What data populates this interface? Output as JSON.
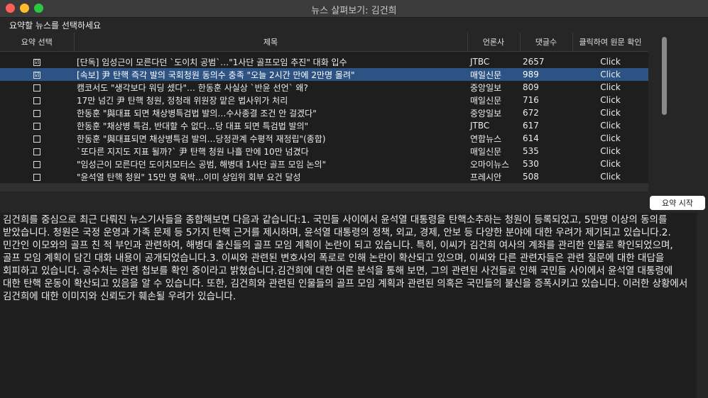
{
  "window": {
    "title": "뉴스 살펴보기: 김건희"
  },
  "colors": {
    "close": "#fe5f57",
    "minimize": "#febc2e",
    "maximize": "#28c840",
    "selection": "#2c5383"
  },
  "prompt": "요약할 뉴스를 선택하세요",
  "table": {
    "headers": {
      "select": "요약 선택",
      "title": "제목",
      "publisher": "언론사",
      "comments": "댓글수",
      "link": "클릭하여 원문 확인"
    },
    "rows": [
      {
        "checked": "☑",
        "title": "[단독] 임성근이 모른다던 `도이치 공범`…\"1사단 골프모임 추진\" 대화 입수",
        "publisher": "JTBC",
        "comments": "2657",
        "link": "Click"
      },
      {
        "checked": "☑",
        "title": "[속보] 尹 탄핵 즉각 발의 국회청원 동의수 충족 \"오늘 2시간 만에 2만명 몰려\"",
        "publisher": "매일신문",
        "comments": "989",
        "link": "Click"
      },
      {
        "checked": "",
        "title": "캠코서도 \"생각보다 워딩 셌다\"… 한동훈 사실상 `반윤 선언` 왜?",
        "publisher": "중앙일보",
        "comments": "809",
        "link": "Click"
      },
      {
        "checked": "",
        "title": "17만 넘긴 尹 탄핵 청원, 정청래 위원장 맡은 법사위가 처리",
        "publisher": "매일신문",
        "comments": "716",
        "link": "Click"
      },
      {
        "checked": "",
        "title": "한동훈 \"與대표 되면 채상병특검법 발의…수사종결 조건 안 걸겠다\"",
        "publisher": "중앙일보",
        "comments": "672",
        "link": "Click"
      },
      {
        "checked": "",
        "title": "한동훈 \"채상병 특검, 반대할 수 없다…당 대표 되면 특검법 발의\"",
        "publisher": "JTBC",
        "comments": "617",
        "link": "Click"
      },
      {
        "checked": "",
        "title": "한동훈 \"與대표되면 채상병특검 발의…당정관계 수평적 재정립\"(종합)",
        "publisher": "연합뉴스",
        "comments": "614",
        "link": "Click"
      },
      {
        "checked": "",
        "title": "`또다른 지지도 지표 될까?` 尹 탄핵 청원 나흘 만에 10만 넘겼다",
        "publisher": "매일신문",
        "comments": "535",
        "link": "Click"
      },
      {
        "checked": "",
        "title": "\"임성근이 모른다던 도이치모터스 공범, 해병대 1사단 골프 모임 논의\"",
        "publisher": "오마이뉴스",
        "comments": "530",
        "link": "Click"
      },
      {
        "checked": "",
        "title": "\"윤석열 탄핵 청원\" 15만 명 육박…이미 상임위 회부 요건 달성",
        "publisher": "프레시안",
        "comments": "508",
        "link": "Click"
      }
    ]
  },
  "summarize_button": "요약 시작",
  "summary_text": "김건희를 중심으로 최근 다뤄진 뉴스기사들을 종합해보면 다음과 같습니다:1. 국민들 사이에서 윤석열 대통령을 탄핵소추하는 청원이 등록되었고, 5만명 이상의 동의를 받았습니다. 청원은 국정 운영과 가족 문제 등 5가지 탄핵 근거를 제시하며, 윤석열 대통령의 정책, 외교, 경제, 안보 등 다양한 분야에 대한 우려가 제기되고 있습니다.2. 민간인 이모와의 골프 친 적 부인과 관련하여, 해병대 출신들의 골프 모임 계획이 논란이 되고 있습니다. 특히, 이씨가 김건희 여사의 계좌를 관리한 인물로 확인되었으며, 골프 모임 계획이 담긴 대화 내용이 공개되었습니다.3. 이씨와 관련된 변호사의 폭로로 인해 논란이 확산되고 있으며, 이씨와 다른 관련자들은 관련 질문에 대한 대답을 회피하고 있습니다. 공수처는 관련 첩보를 확인 중이라고 밝혔습니다.김건희에 대한 여론 분석을 통해 보면, 그의 관련된 사건들로 인해 국민들 사이에서 윤석열 대통령에 대한 탄핵 운동이 확산되고 있음을 알 수 있습니다. 또한, 김건희와 관련된 인물들의 골프 모임 계획과 관련된 의혹은 국민들의 불신을 증폭시키고 있습니다. 이러한 상황에서 김건희에 대한 이미지와 신뢰도가 훼손될 우려가 있습니다."
}
